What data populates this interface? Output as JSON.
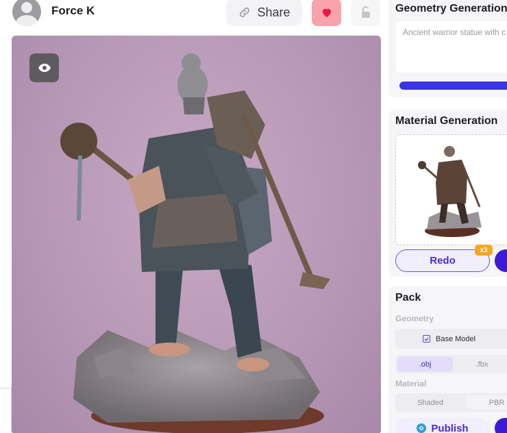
{
  "header": {
    "username": "Force K",
    "share_label": "Share"
  },
  "panels": {
    "geometry": {
      "title": "Geometry Generation",
      "prompt_text": "Ancient warrior statue with c",
      "progress": 1.0
    },
    "material": {
      "title": "Material Generation",
      "redo_label": "Redo",
      "redo_badge": "x3"
    },
    "pack": {
      "title": "Pack",
      "geometry_label": "Geometry",
      "base_model_label": "Base Model",
      "formats": [
        ".obj",
        ".fbx"
      ],
      "selected_format": ".obj",
      "material_label": "Material",
      "material_options": [
        "Shaded",
        "PBR"
      ],
      "publish_label": "Publish"
    }
  },
  "colors": {
    "accent": "#3c1bd8",
    "like": "#f7a2ad",
    "progress": "#3b34e6",
    "viewer_bg": "#c0a2c0"
  }
}
